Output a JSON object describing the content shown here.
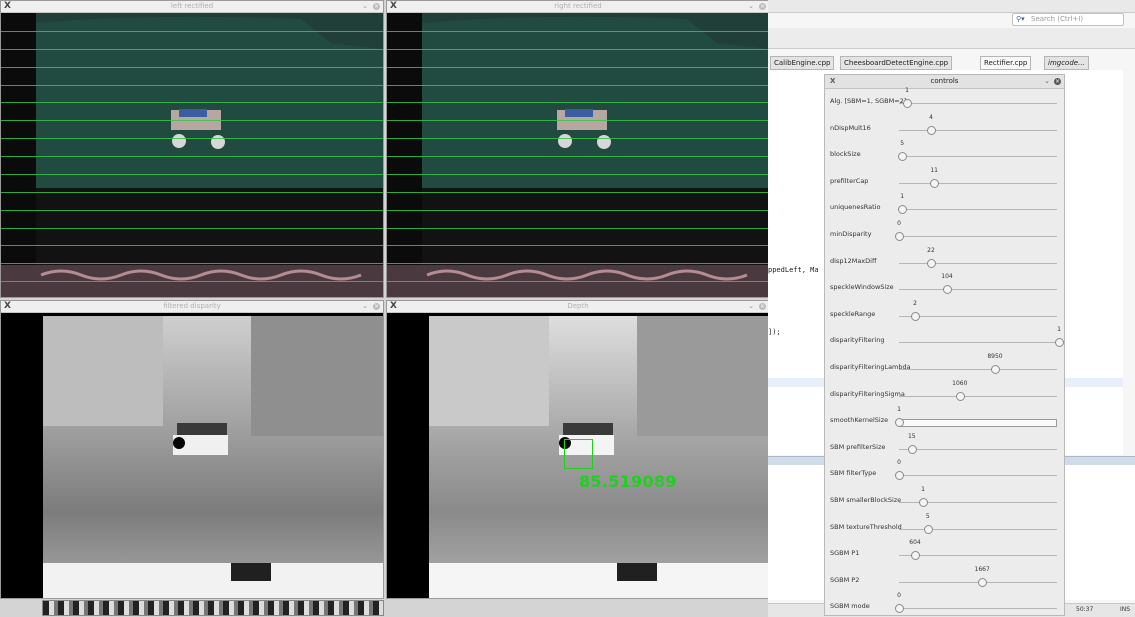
{
  "windows": {
    "left": {
      "title": "left rectified"
    },
    "right": {
      "title": "right rectified"
    },
    "filtered": {
      "title": "filtered disparity"
    },
    "depth": {
      "title": "Depth"
    }
  },
  "depth_overlay": {
    "value": "85.519089"
  },
  "ide": {
    "search_placeholder": "Search (Ctrl+I)",
    "tabs": [
      "CalibEngine.cpp",
      "CheesboardDetectEngine.cpp",
      "Rectifier.cpp",
      "imgcode..."
    ],
    "code": {
      "line1": "ppedLeft, Ma",
      "line2": "]);"
    },
    "status": {
      "position": "50:37",
      "mode": "INS"
    }
  },
  "controls": {
    "title": "controls",
    "items": [
      {
        "label": "Alg. [SBM=1, SGBM=2]",
        "value": "1",
        "position": 0.05
      },
      {
        "label": "nDispMult16",
        "value": "4",
        "position": 0.2
      },
      {
        "label": "blockSize",
        "value": "5",
        "position": 0.02
      },
      {
        "label": "prefilterCap",
        "value": "11",
        "position": 0.22
      },
      {
        "label": "uniquenesRatio",
        "value": "1",
        "position": 0.02
      },
      {
        "label": "minDisparity",
        "value": "0",
        "position": 0.0
      },
      {
        "label": "disp12MaxDiff",
        "value": "22",
        "position": 0.2
      },
      {
        "label": "speckleWindowSize",
        "value": "104",
        "position": 0.3
      },
      {
        "label": "speckleRange",
        "value": "2",
        "position": 0.1
      },
      {
        "label": "disparityFiltering",
        "value": "1",
        "position": 1.0
      },
      {
        "label": "disparityFilteringLambda",
        "value": "8950",
        "position": 0.6
      },
      {
        "label": "disparityFilteringSigma",
        "value": "1060",
        "position": 0.38
      },
      {
        "label": "smoothKernelSize",
        "value": "1",
        "position": 0.0,
        "focused": true
      },
      {
        "label": "SBM prefilterSize",
        "value": "15",
        "position": 0.08
      },
      {
        "label": "SBM filterType",
        "value": "0",
        "position": 0.0
      },
      {
        "label": "SBM smallerBlockSize",
        "value": "1",
        "position": 0.15
      },
      {
        "label": "SBM textureThreshold",
        "value": "5",
        "position": 0.18
      },
      {
        "label": "SGBM P1",
        "value": "604",
        "position": 0.1
      },
      {
        "label": "SGBM P2",
        "value": "1667",
        "position": 0.52
      },
      {
        "label": "SGBM mode",
        "value": "0",
        "position": 0.0
      }
    ]
  }
}
